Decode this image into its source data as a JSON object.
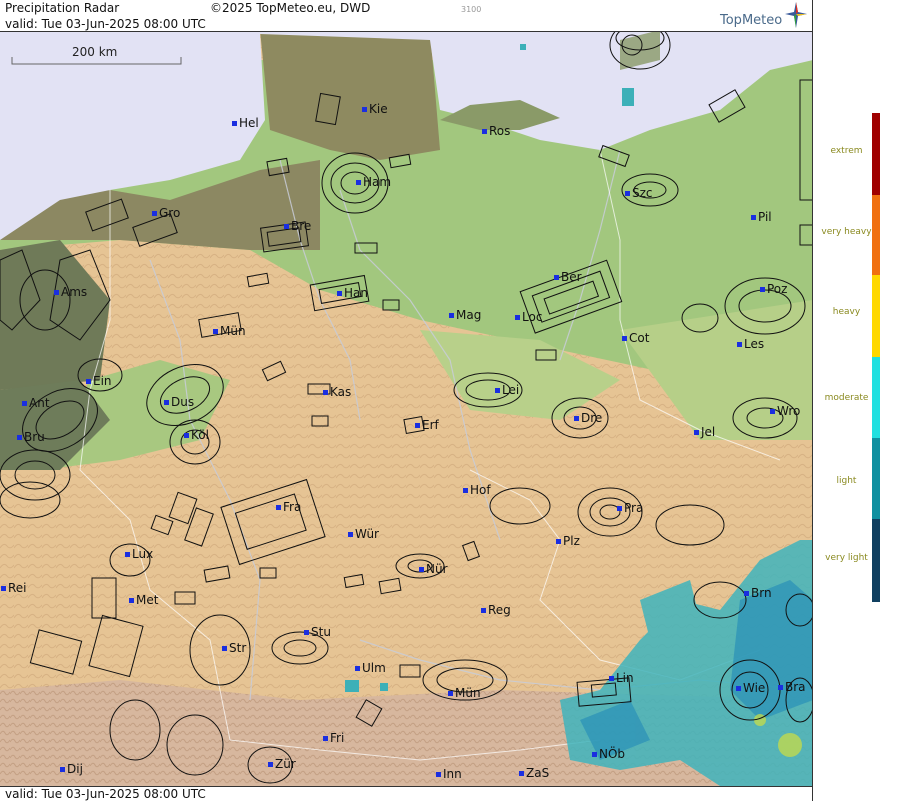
{
  "header": {
    "title": "Precipitation Radar",
    "copyright": "©2025 TopMeteo.eu, DWD",
    "valid": "valid:  Tue   03-Jun-2025 08:00 UTC",
    "code": "3100",
    "brand": "TopMeteo"
  },
  "footer": {
    "valid": "valid:  Tue   03-Jun-2025 08:00 UTC"
  },
  "scale": {
    "label": "200 km"
  },
  "cities": [
    {
      "name": "Hel"
    },
    {
      "name": "Kie"
    },
    {
      "name": "Ros"
    },
    {
      "name": "Ham"
    },
    {
      "name": "Szc"
    },
    {
      "name": "Gro"
    },
    {
      "name": "Bre"
    },
    {
      "name": "Pil"
    },
    {
      "name": "Ams"
    },
    {
      "name": "Han"
    },
    {
      "name": "Ber"
    },
    {
      "name": "Poz"
    },
    {
      "name": "Mün"
    },
    {
      "name": "Mag"
    },
    {
      "name": "Loc"
    },
    {
      "name": "Cot"
    },
    {
      "name": "Les"
    },
    {
      "name": "Ein"
    },
    {
      "name": "Kas"
    },
    {
      "name": "Lei"
    },
    {
      "name": "Ant"
    },
    {
      "name": "Dus"
    },
    {
      "name": "Wro"
    },
    {
      "name": "Bru"
    },
    {
      "name": "Köl"
    },
    {
      "name": "Erf"
    },
    {
      "name": "Dre"
    },
    {
      "name": "Jel"
    },
    {
      "name": "Hof"
    },
    {
      "name": "Fra"
    },
    {
      "name": "Pra"
    },
    {
      "name": "Wür"
    },
    {
      "name": "Plz"
    },
    {
      "name": "Lux"
    },
    {
      "name": "Nür"
    },
    {
      "name": "Rei"
    },
    {
      "name": "Met"
    },
    {
      "name": "Reg"
    },
    {
      "name": "Brn"
    },
    {
      "name": "Stu"
    },
    {
      "name": "Str"
    },
    {
      "name": "Ulm"
    },
    {
      "name": "Mün"
    },
    {
      "name": "Lin"
    },
    {
      "name": "Wie"
    },
    {
      "name": "Bra"
    },
    {
      "name": "Fri"
    },
    {
      "name": "NÖb"
    },
    {
      "name": "Dij"
    },
    {
      "name": "Zür"
    },
    {
      "name": "Inn"
    },
    {
      "name": "ZaS"
    }
  ],
  "legend": {
    "levels": [
      {
        "label": "extrem",
        "color": "#a00000"
      },
      {
        "label": "very heavy",
        "color": "#f07010"
      },
      {
        "label": "heavy",
        "color": "#ffd800"
      },
      {
        "label": "moderate",
        "color": "#20e0e0"
      },
      {
        "label": "light",
        "color": "#1090a0"
      },
      {
        "label": "very light",
        "color": "#104060"
      }
    ]
  },
  "colors": {
    "sea": "#e2e2f4",
    "lowland_green": "#9cc47a",
    "coastal_brown": "#8a8560",
    "upland_tan": "#e4c090",
    "alpine": "#d9b8a0",
    "precip_cyan": "#3ab8c0",
    "city_dot": "#1a2ee0"
  }
}
